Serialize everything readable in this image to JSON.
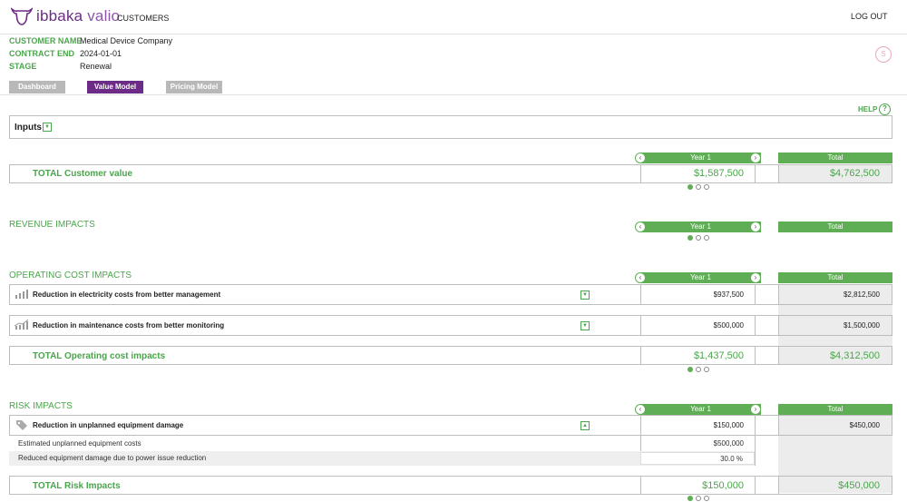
{
  "header": {
    "logo_brand": "ibbaka",
    "logo_product": "valio",
    "nav_customers": "CUSTOMERS",
    "logout": "LOG OUT"
  },
  "customer": {
    "name_label": "CUSTOMER NAME",
    "name_value": "Medical Device Company",
    "contract_label": "CONTRACT END",
    "contract_value": "2024-01-01",
    "stage_label": "STAGE",
    "stage_value": "Renewal",
    "status_button": "S"
  },
  "tabs": [
    {
      "label": "Dashboard",
      "active": false
    },
    {
      "label": "Value Model",
      "active": true
    },
    {
      "label": "Pricing Model",
      "active": false
    }
  ],
  "help_label": "HELP",
  "help_icon": "?",
  "inputs": {
    "label": "Inputs"
  },
  "columns": {
    "year": "Year 1",
    "total": "Total",
    "prev": "‹",
    "next": "›"
  },
  "customer_value": {
    "label": "TOTAL Customer value",
    "year": "$1,587,500",
    "total": "$4,762,500"
  },
  "revenue": {
    "title": "REVENUE IMPACTS"
  },
  "operating": {
    "title": "OPERATING COST IMPACTS",
    "items": [
      {
        "icon": "bar-chart-icon",
        "label": "Reduction in electricity costs from better management",
        "year": "$937,500",
        "total": "$2,812,500"
      },
      {
        "icon": "trend-chart-icon",
        "label": "Reduction in maintenance costs from better monitoring",
        "year": "$500,000",
        "total": "$1,500,000"
      }
    ],
    "total": {
      "label": "TOTAL Operating cost impacts",
      "year": "$1,437,500",
      "total": "$4,312,500"
    }
  },
  "risk": {
    "title": "RISK IMPACTS",
    "item": {
      "icon": "tag-icon",
      "label": "Reduction in unplanned equipment damage",
      "year": "$150,000",
      "total": "$450,000"
    },
    "sub_items": [
      {
        "label": "Estimated unplanned equipment costs",
        "value": "$500,000"
      },
      {
        "label": "Reduced equipment damage due to power issue reduction",
        "value": "30.0 %"
      }
    ],
    "total": {
      "label": "TOTAL Risk Impacts",
      "year": "$150,000",
      "total": "$450,000"
    }
  },
  "colors": {
    "accent_green": "#4aa64b",
    "bar_green": "#5fae55",
    "brand_purple": "#6b2b86"
  }
}
